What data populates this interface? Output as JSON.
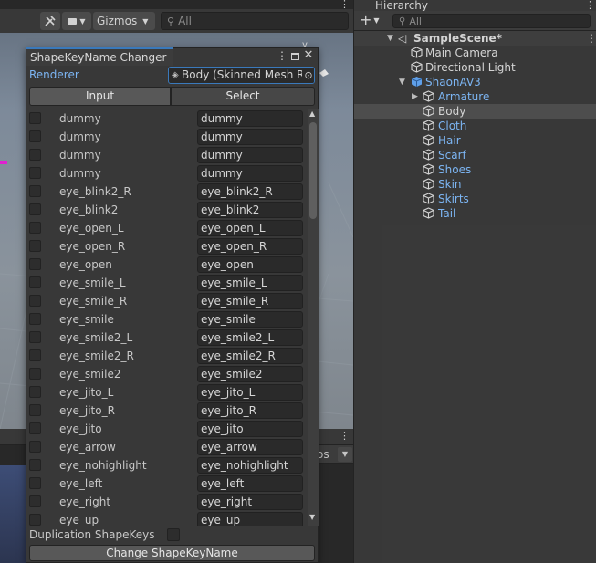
{
  "scene_toolbar": {
    "gizmos_label": "Gizmos",
    "search_placeholder": "All"
  },
  "game_view": {
    "partial_label": "os"
  },
  "hierarchy": {
    "tab_label": "Hierarchy",
    "search_placeholder": "All",
    "add_label": "+",
    "items": [
      {
        "label": "SampleScene*",
        "style": "scene"
      },
      {
        "label": "Main Camera",
        "style": "white"
      },
      {
        "label": "Directional Light",
        "style": "white"
      },
      {
        "label": "ShaonAV3",
        "style": "blue"
      },
      {
        "label": "Armature",
        "style": "blue"
      },
      {
        "label": "Body",
        "style": "white"
      },
      {
        "label": "Cloth",
        "style": "blue"
      },
      {
        "label": "Hair",
        "style": "blue"
      },
      {
        "label": "Scarf",
        "style": "blue"
      },
      {
        "label": "Shoes",
        "style": "blue"
      },
      {
        "label": "Skin",
        "style": "blue"
      },
      {
        "label": "Skirts",
        "style": "blue"
      },
      {
        "label": "Tail",
        "style": "blue"
      }
    ]
  },
  "window": {
    "title": "ShapeKeyName Changer",
    "renderer_label": "Renderer",
    "renderer_value": "Body (Skinned Mesh R",
    "tab_input": "Input",
    "tab_select": "Select",
    "shape_keys": [
      {
        "name": "dummy",
        "value": "dummy"
      },
      {
        "name": "dummy",
        "value": "dummy"
      },
      {
        "name": "dummy",
        "value": "dummy"
      },
      {
        "name": "dummy",
        "value": "dummy"
      },
      {
        "name": "eye_blink2_R",
        "value": "eye_blink2_R"
      },
      {
        "name": "eye_blink2",
        "value": "eye_blink2"
      },
      {
        "name": "eye_open_L",
        "value": "eye_open_L"
      },
      {
        "name": "eye_open_R",
        "value": "eye_open_R"
      },
      {
        "name": "eye_open",
        "value": "eye_open"
      },
      {
        "name": "eye_smile_L",
        "value": "eye_smile_L"
      },
      {
        "name": "eye_smile_R",
        "value": "eye_smile_R"
      },
      {
        "name": "eye_smile",
        "value": "eye_smile"
      },
      {
        "name": "eye_smile2_L",
        "value": "eye_smile2_L"
      },
      {
        "name": "eye_smile2_R",
        "value": "eye_smile2_R"
      },
      {
        "name": "eye_smile2",
        "value": "eye_smile2"
      },
      {
        "name": "eye_jito_L",
        "value": "eye_jito_L"
      },
      {
        "name": "eye_jito_R",
        "value": "eye_jito_R"
      },
      {
        "name": "eye_jito",
        "value": "eye_jito"
      },
      {
        "name": "eye_arrow",
        "value": "eye_arrow"
      },
      {
        "name": "eye_nohighlight",
        "value": "eye_nohighlight"
      },
      {
        "name": "eye_left",
        "value": "eye_left"
      },
      {
        "name": "eye_right",
        "value": "eye_right"
      },
      {
        "name": "eye_up",
        "value": "eye_up"
      }
    ],
    "duplication_label": "Duplication ShapeKeys",
    "change_button": "Change ShapeKeyName"
  }
}
